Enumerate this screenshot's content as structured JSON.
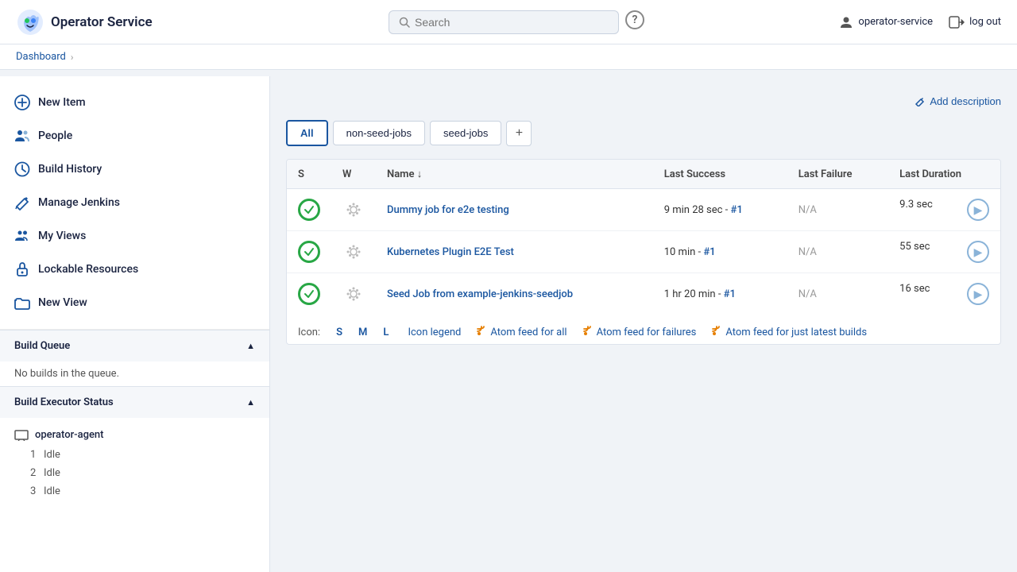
{
  "app": {
    "title": "Operator Service",
    "logo_alt": "Jenkins Logo"
  },
  "header": {
    "search_placeholder": "Search",
    "user_label": "operator-service",
    "logout_label": "log out",
    "help_char": "?"
  },
  "breadcrumb": {
    "dashboard_label": "Dashboard",
    "arrow": "›"
  },
  "sidebar": {
    "nav_items": [
      {
        "id": "new-item",
        "label": "New Item",
        "icon": "plus-circle"
      },
      {
        "id": "people",
        "label": "People",
        "icon": "people"
      },
      {
        "id": "build-history",
        "label": "Build History",
        "icon": "clock"
      },
      {
        "id": "manage-jenkins",
        "label": "Manage Jenkins",
        "icon": "pencil"
      },
      {
        "id": "my-views",
        "label": "My Views",
        "icon": "people-small"
      },
      {
        "id": "lockable-resources",
        "label": "Lockable Resources",
        "icon": "lock"
      },
      {
        "id": "new-view",
        "label": "New View",
        "icon": "folder"
      }
    ],
    "build_queue": {
      "title": "Build Queue",
      "empty_label": "No builds in the queue.",
      "collapsed": false
    },
    "build_executor": {
      "title": "Build Executor Status",
      "collapsed": false,
      "agent": "operator-agent",
      "executors": [
        {
          "number": "1",
          "status": "Idle"
        },
        {
          "number": "2",
          "status": "Idle"
        },
        {
          "number": "3",
          "status": "Idle"
        }
      ]
    }
  },
  "main": {
    "add_description_label": "Add description",
    "tabs": [
      {
        "id": "all",
        "label": "All",
        "active": true
      },
      {
        "id": "non-seed-jobs",
        "label": "non-seed-jobs",
        "active": false
      },
      {
        "id": "seed-jobs",
        "label": "seed-jobs",
        "active": false
      }
    ],
    "table": {
      "columns": [
        "S",
        "W",
        "Name ↓",
        "Last Success",
        "Last Failure",
        "Last Duration"
      ],
      "rows": [
        {
          "status": "ok",
          "name": "Dummy job for e2e testing",
          "last_success": "9 min 28 sec - #1",
          "last_failure": "N/A",
          "last_duration": "9.3 sec"
        },
        {
          "status": "ok",
          "name": "Kubernetes Plugin E2E Test",
          "last_success": "10 min - #1",
          "last_failure": "N/A",
          "last_duration": "55 sec"
        },
        {
          "status": "ok",
          "name": "Seed Job from example-jenkins-seedjob",
          "last_success": "1 hr 20 min - #1",
          "last_failure": "N/A",
          "last_duration": "16 sec"
        }
      ]
    },
    "footer": {
      "icon_label": "Icon:",
      "sizes": [
        "S",
        "M",
        "L"
      ],
      "icon_legend_label": "Icon legend",
      "feeds": [
        {
          "id": "feed-all",
          "label": "Atom feed for all"
        },
        {
          "id": "feed-failures",
          "label": "Atom feed for failures"
        },
        {
          "id": "feed-latest",
          "label": "Atom feed for just latest builds"
        }
      ]
    }
  }
}
